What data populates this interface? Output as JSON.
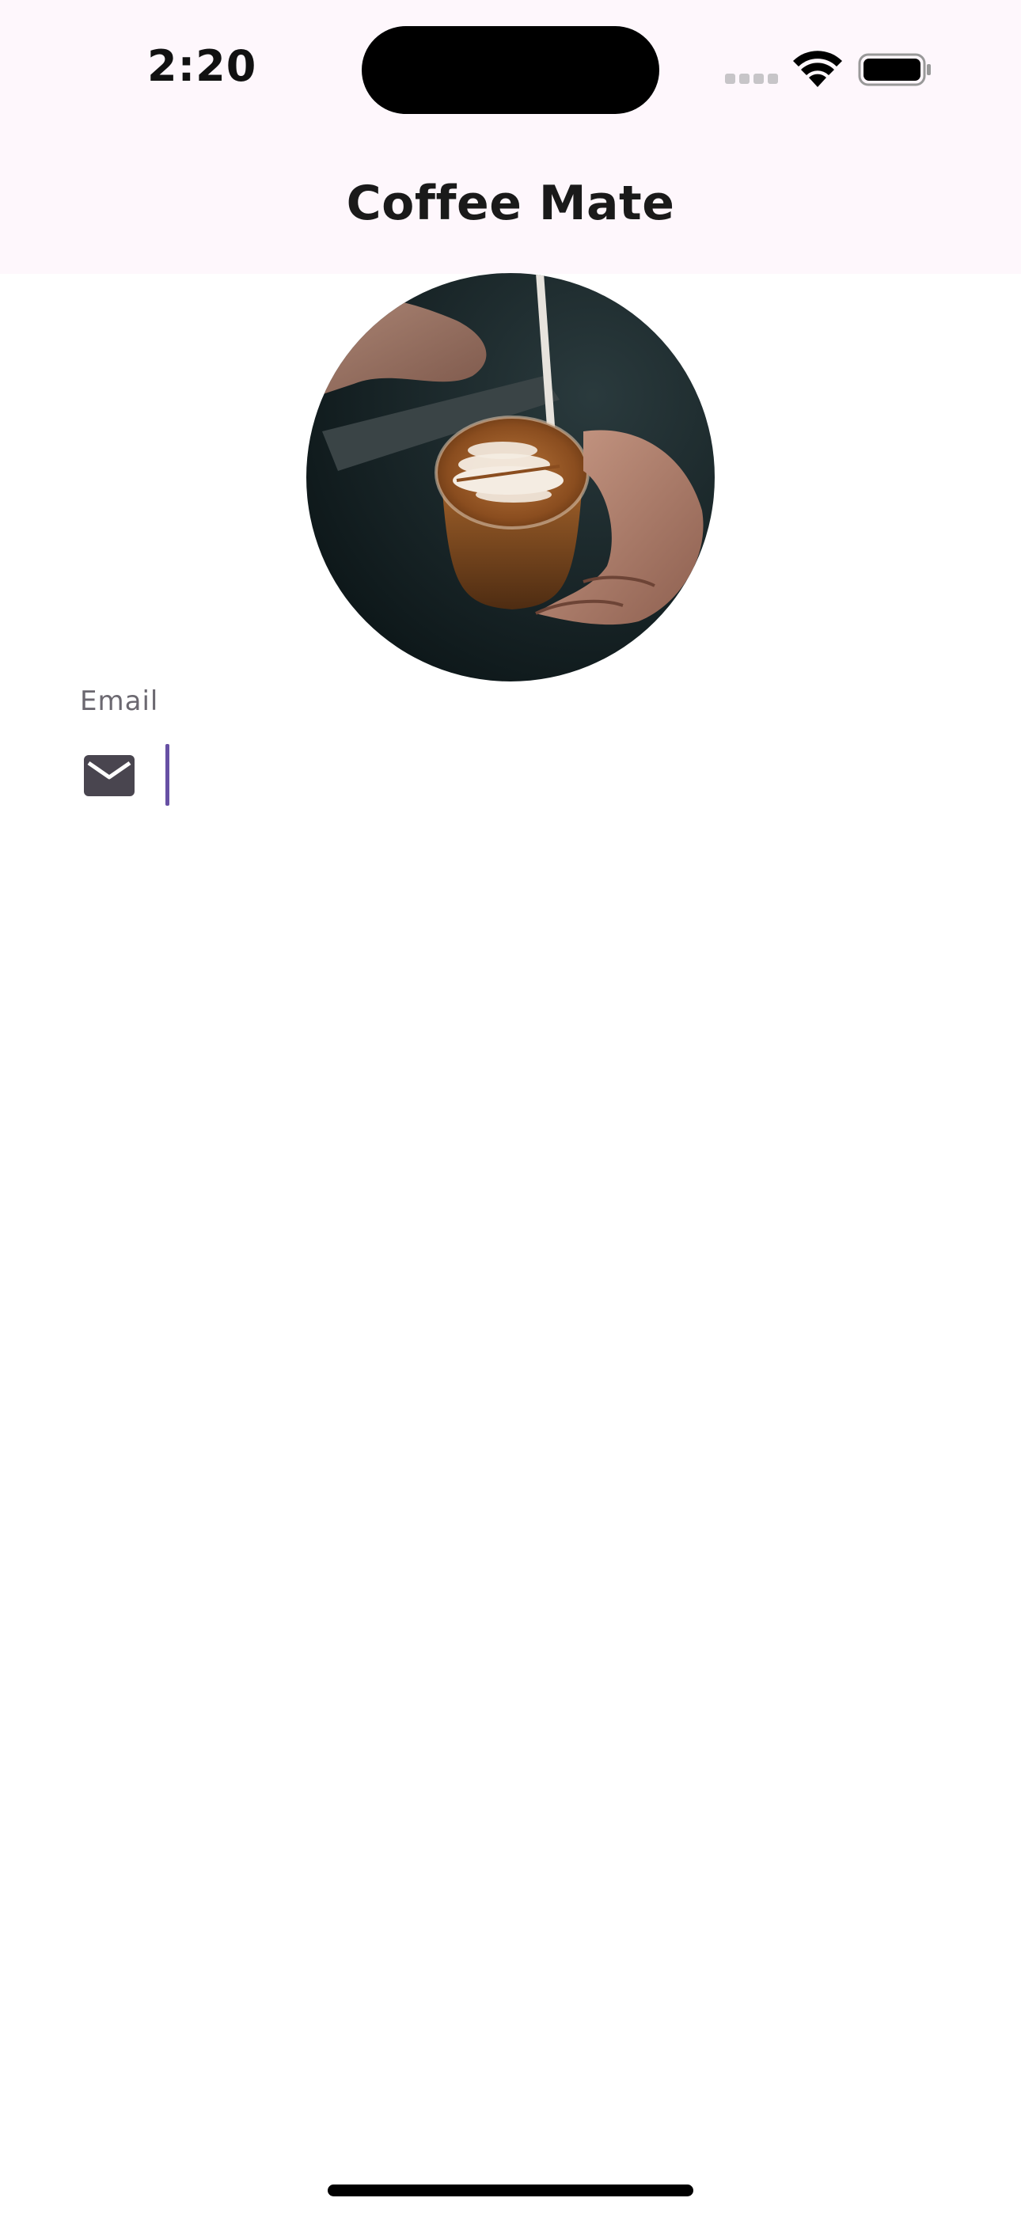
{
  "status_bar": {
    "time": "2:20",
    "icons": [
      "cellular-signal-icon",
      "wifi-icon",
      "battery-icon"
    ]
  },
  "app_bar": {
    "title": "Coffee Mate"
  },
  "hero_image": {
    "icon": "latte-art-photo"
  },
  "email_field": {
    "label": "Email",
    "value": "",
    "icon": "mail-icon",
    "cursor_color": "#6750a4"
  },
  "colors": {
    "header_background": "#fef7fc",
    "page_background": "#ffffff",
    "accent": "#6750a4",
    "icon_color": "#49454f"
  }
}
